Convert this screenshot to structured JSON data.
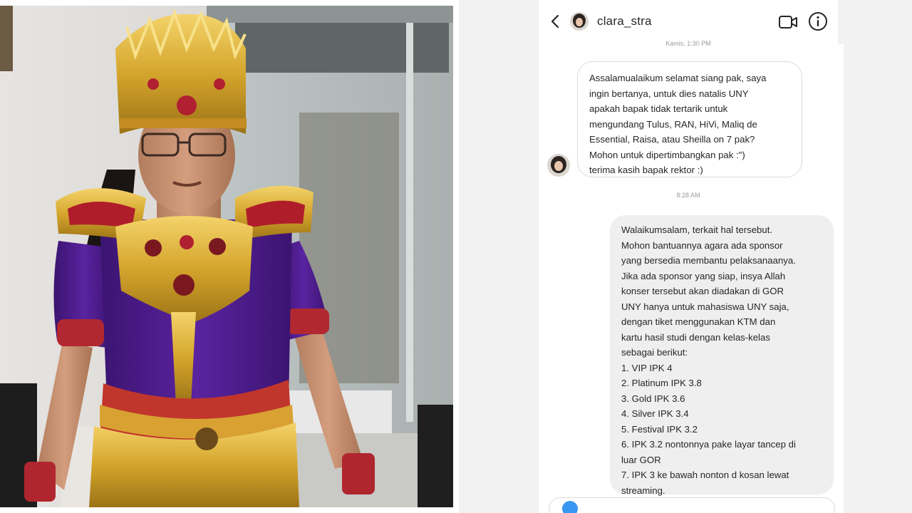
{
  "photo": {
    "subject": "man in traditional costume"
  },
  "chat": {
    "header": {
      "username": "clara_stra",
      "back_icon": "chevron-left-icon",
      "video_icon": "video-call-icon",
      "info_icon": "info-icon"
    },
    "timestamps": {
      "top": "Kamis, 1:30 PM",
      "middle": "8:28 AM"
    },
    "incoming": {
      "lines": [
        "Assalamualaikum selamat siang pak, saya",
        "ingin bertanya, untuk dies natalis UNY",
        "apakah bapak tidak tertarik untuk",
        "mengundang Tulus, RAN, HiVi, Maliq de",
        "Essential, Raisa, atau Sheilla on 7 pak?",
        "Mohon untuk dipertimbangkan pak :\")",
        "terima kasih bapak rektor :)"
      ]
    },
    "outgoing": {
      "lines": [
        "Walaikumsalam, terkait hal tersebut.",
        "Mohon bantuannya agara ada sponsor",
        "yang bersedia membantu pelaksanaanya.",
        "Jika ada sponsor yang siap, insya Allah",
        "konser tersebut akan diadakan di GOR",
        "UNY hanya untuk mahasiswa UNY saja,",
        "dengan tiket menggunakan KTM dan",
        "kartu hasil studi dengan kelas-kelas",
        "sebagai berikut:",
        "1. VIP  IPK 4",
        "2. Platinum IPK 3.8",
        "3. Gold IPK 3.6",
        "4. Silver IPK 3.4",
        "5. Festival IPK 3.2",
        "6. IPK 3.2 nontonnya pake layar tancep di",
        "luar GOR",
        "7. IPK 3 ke bawah nonton d kosan lewat",
        "streaming."
      ]
    }
  }
}
